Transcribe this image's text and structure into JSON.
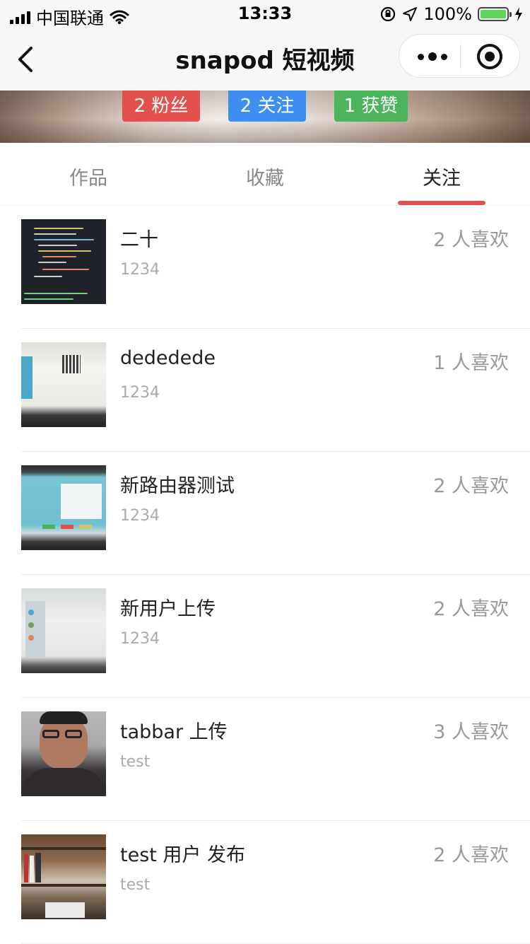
{
  "status_bar": {
    "carrier": "中国联通",
    "time": "13:33",
    "battery": "100%"
  },
  "nav": {
    "title": "snapod 短视频"
  },
  "stats": {
    "fans": "2 粉丝",
    "following": "2 关注",
    "likes": "1 获赞"
  },
  "tabs": [
    {
      "label": "作品"
    },
    {
      "label": "收藏"
    },
    {
      "label": "关注",
      "active": true
    }
  ],
  "items": [
    {
      "title": "二十",
      "subtitle": "1234",
      "likes": "2 人喜欢",
      "thumb": "code-screen"
    },
    {
      "title": "dededede",
      "subtitle": "1234",
      "likes": "1 人喜欢",
      "thumb": "laptop-white"
    },
    {
      "title": "新路由器测试",
      "subtitle": "1234",
      "likes": "2 人喜欢",
      "thumb": "laptop-blue"
    },
    {
      "title": "新用户上传",
      "subtitle": "1234",
      "likes": "2 人喜欢",
      "thumb": "laptop-grey"
    },
    {
      "title": "tabbar 上传",
      "subtitle": "test",
      "likes": "3 人喜欢",
      "thumb": "person"
    },
    {
      "title": "test 用户 发布",
      "subtitle": "test",
      "likes": "2 人喜欢",
      "thumb": "bookshelf"
    }
  ],
  "colors": {
    "fans": "#e2514d",
    "following": "#3d8ef0",
    "likes": "#4cb55b",
    "tab_indicator": "#e2514d"
  }
}
